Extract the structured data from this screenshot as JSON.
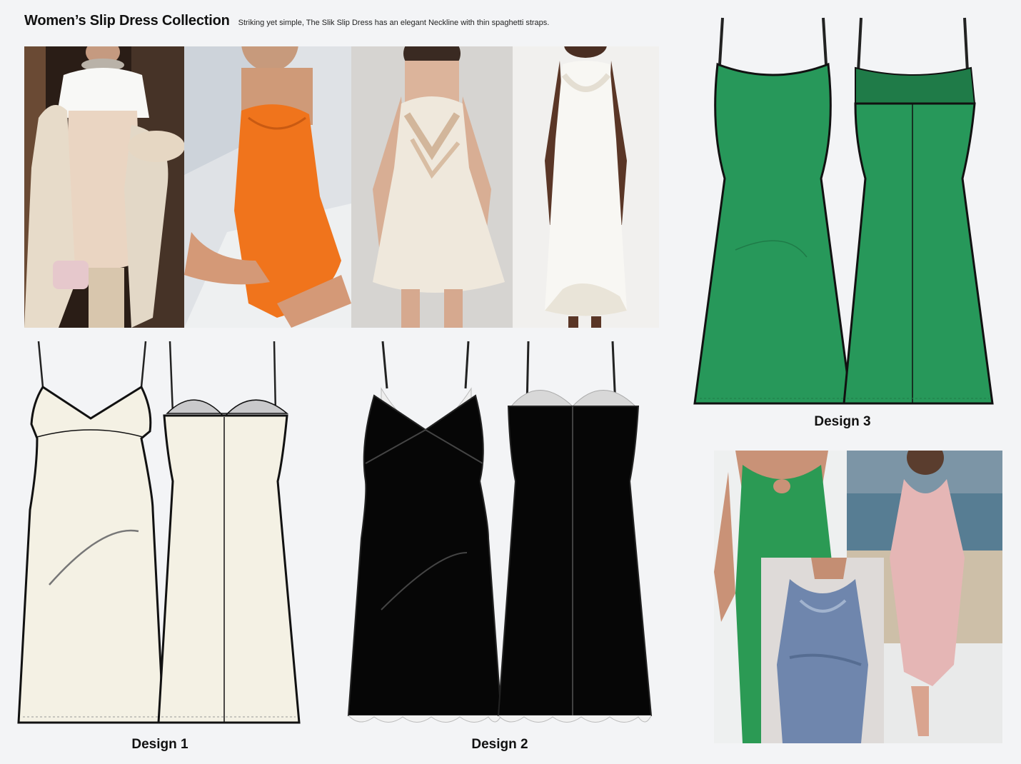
{
  "header": {
    "title": "Women’s Slip Dress Collection",
    "subtitle": "Striking yet simple, The Slik Slip Dress has an elegant Neckline with thin spaghetti straps."
  },
  "designs": [
    {
      "label": "Design 1",
      "color": "#f4f1e4"
    },
    {
      "label": "Design 2",
      "color": "#060606"
    },
    {
      "label": "Design 3",
      "color": "#27985a"
    }
  ],
  "inspiration_photos": [
    {
      "name": "champagne satin slip over white tee",
      "dress_color": "#e8d4c0"
    },
    {
      "name": "orange jacquard mini slip",
      "dress_color": "#f0741c"
    },
    {
      "name": "ivory satin slip with lace trim",
      "dress_color": "#ece6da"
    },
    {
      "name": "white silk lace maxi slip",
      "dress_color": "#f1efe8"
    }
  ],
  "reference_photos": [
    {
      "name": "green halter satin midi",
      "dress_color": "#2b9a54"
    },
    {
      "name": "pink cowl satin maxi",
      "dress_color": "#e5b6b5"
    },
    {
      "name": "blue cowl satin slip",
      "dress_color": "#6f86ad"
    }
  ]
}
